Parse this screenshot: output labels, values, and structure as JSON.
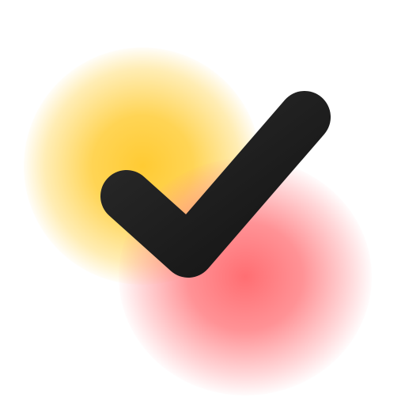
{
  "icon": {
    "name": "checkmark-icon",
    "stroke_color": "#1e1e1e",
    "glow_colors": [
      "#FFC828",
      "#FF5A5F"
    ]
  }
}
